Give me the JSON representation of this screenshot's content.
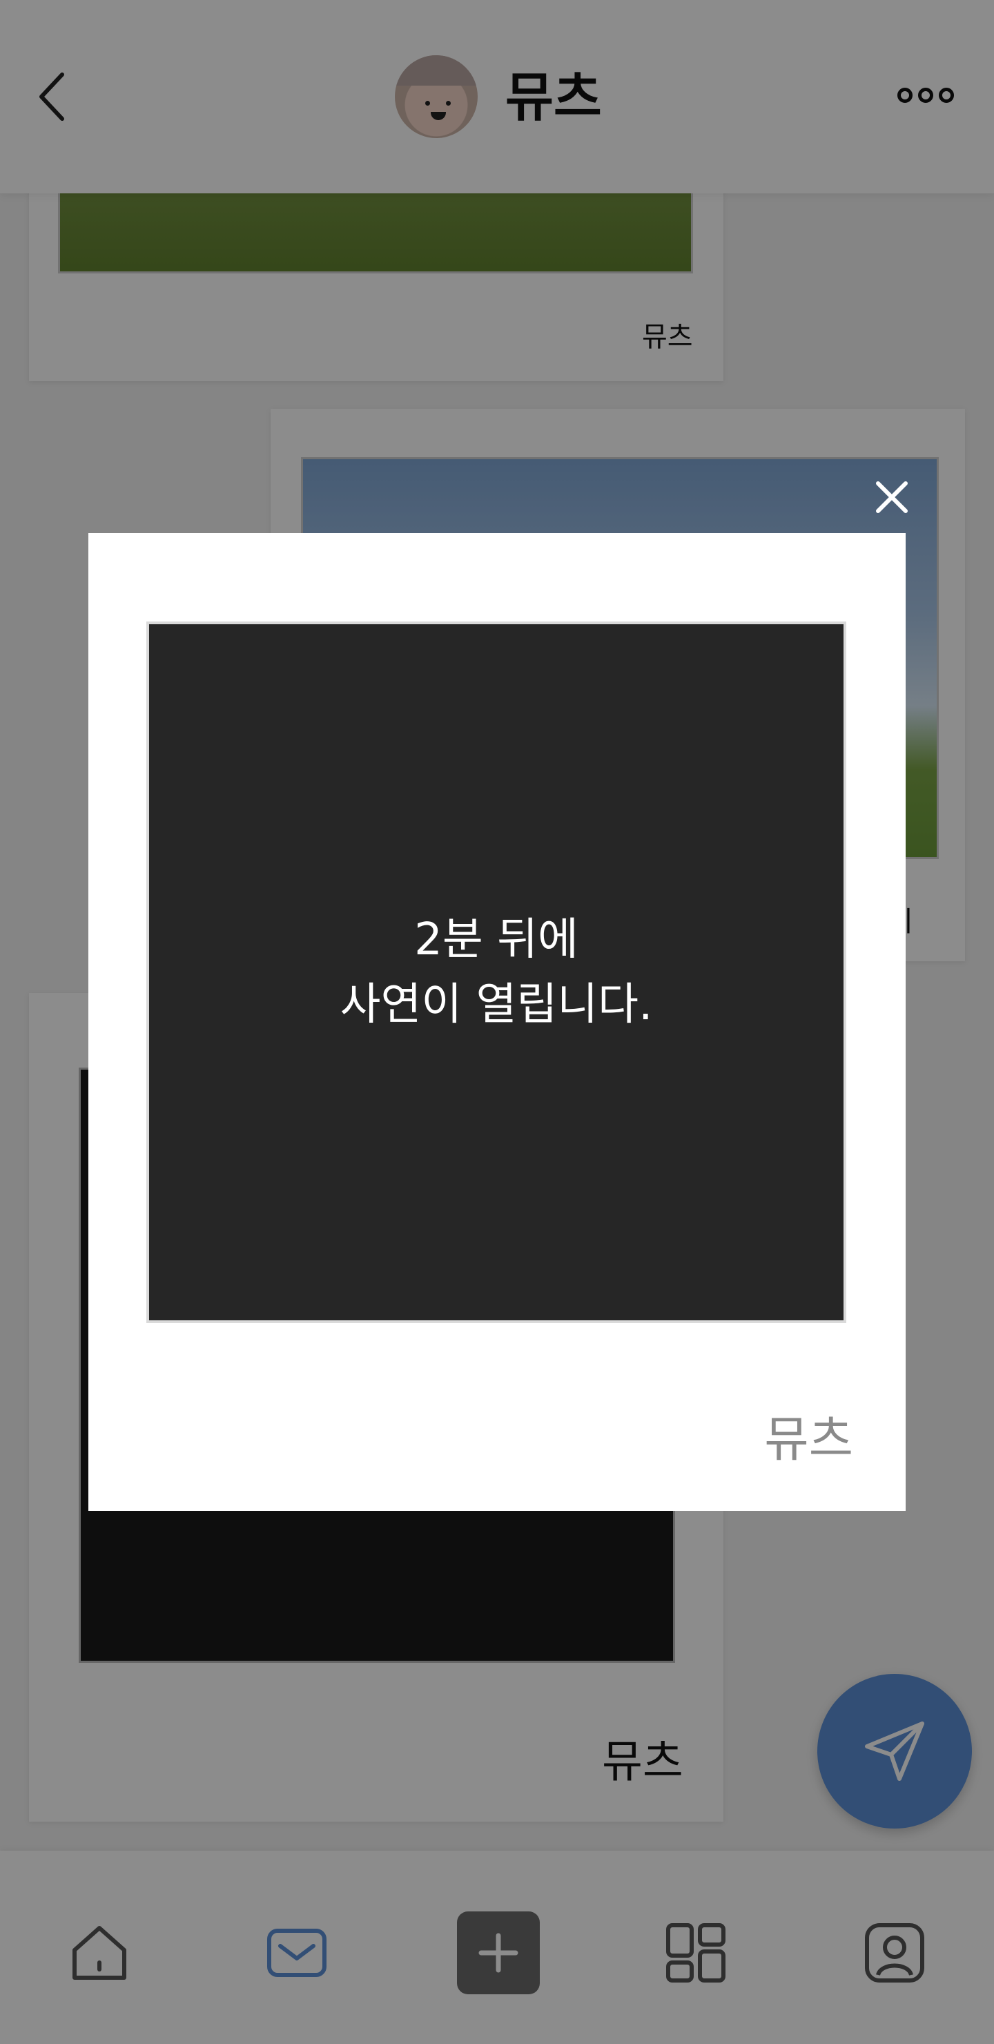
{
  "header": {
    "title": "뮤츠",
    "back_icon": "chevron-left-icon",
    "more_icon": "more-horizontal-icon"
  },
  "feed": {
    "cards": [
      {
        "label": "뮤츠"
      },
      {
        "label": "카메"
      },
      {
        "label": "뮤츠"
      }
    ]
  },
  "fab": {
    "icon": "send-icon",
    "color": "#5b8fd6"
  },
  "bottom_nav": {
    "items": [
      {
        "icon": "home-icon"
      },
      {
        "icon": "mail-icon",
        "active": true
      },
      {
        "icon": "plus-icon"
      },
      {
        "icon": "grid-icon"
      },
      {
        "icon": "profile-icon"
      }
    ],
    "active_color": "#5b8fd6"
  },
  "modal": {
    "message_line1": "2분 뒤에",
    "message_line2": "사연이 열립니다.",
    "sender": "뮤츠",
    "close_icon": "close-icon"
  }
}
